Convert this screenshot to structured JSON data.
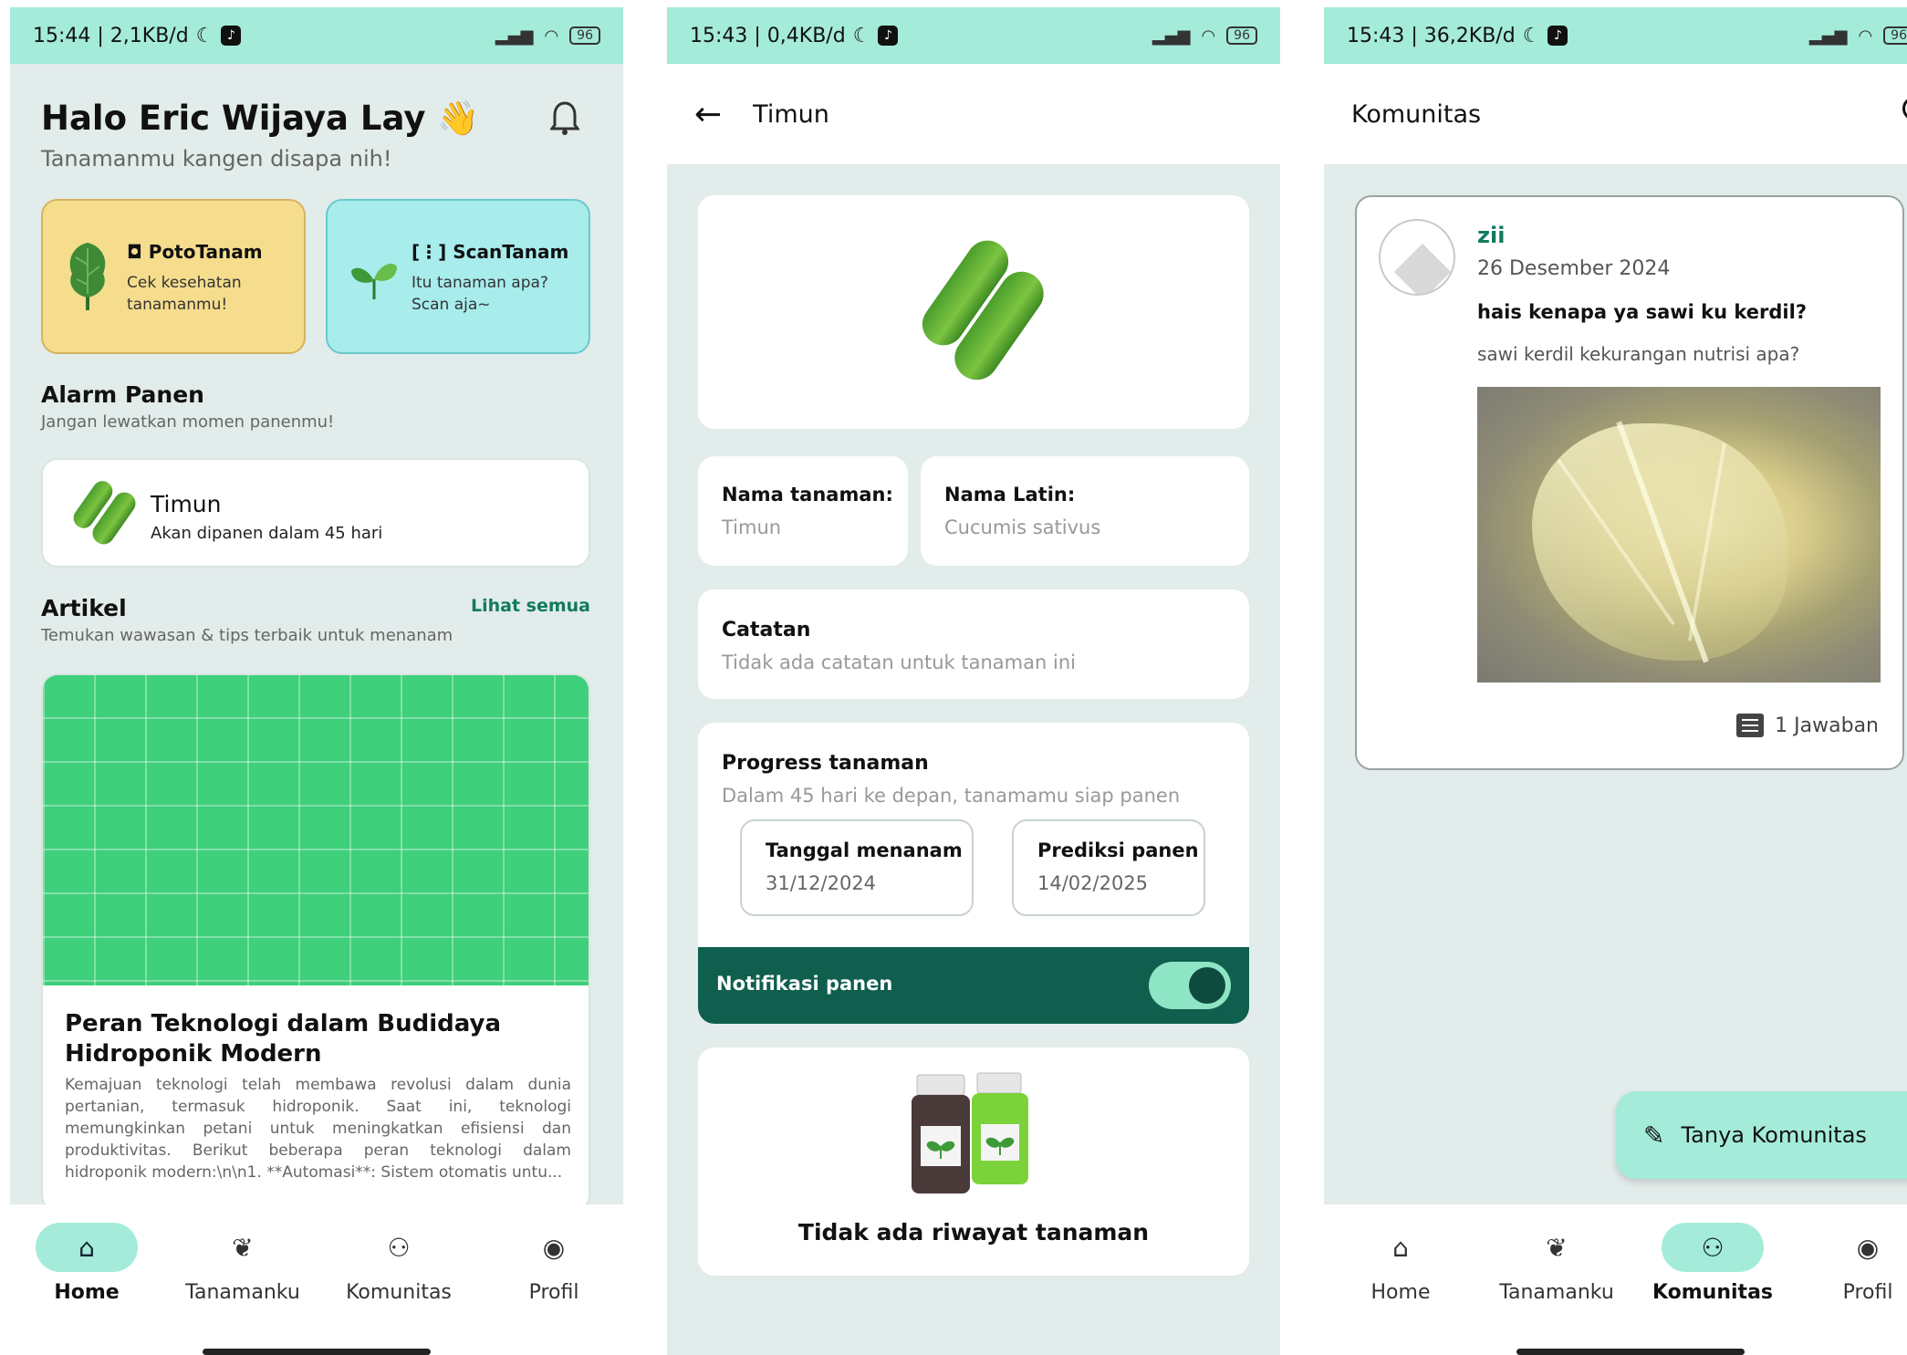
{
  "screens": {
    "home": {
      "status_time": "15:44 | 2,1KB/d",
      "battery": "96",
      "greeting": "Halo Eric Wijaya Lay",
      "wave": "👋",
      "greeting_sub": "Tanamanmu kangen disapa nih!",
      "poto": {
        "title": "PotoTanam",
        "desc": "Cek kesehatan tanamanmu!"
      },
      "scan": {
        "title": "ScanTanam",
        "desc": "Itu tanaman apa? Scan aja~"
      },
      "alarm_title": "Alarm Panen",
      "alarm_sub": "Jangan lewatkan momen panenmu!",
      "alarm_item": {
        "name": "Timun",
        "desc": "Akan dipanen dalam 45 hari"
      },
      "artikel_title": "Artikel",
      "artikel_sub": "Temukan wawasan & tips terbaik untuk menanam",
      "lihat_semua": "Lihat semua",
      "article": {
        "title": "Peran Teknologi dalam Budidaya Hidroponik Modern",
        "body": "Kemajuan teknologi telah membawa revolusi dalam dunia pertanian, termasuk hidroponik. Saat ini, teknologi memungkinkan petani untuk meningkatkan efisiensi dan produktivitas. Berikut beberapa peran teknologi dalam hidroponik modern:\\n\\n1. **Automasi**: Sistem otomatis untu..."
      }
    },
    "detail": {
      "status_time": "15:43 | 0,4KB/d",
      "battery": "96",
      "title": "Timun",
      "nama_label": "Nama tanaman:",
      "nama_value": "Timun",
      "latin_label": "Nama Latin:",
      "latin_value": "Cucumis sativus",
      "catatan_label": "Catatan",
      "catatan_value": "Tidak ada catatan untuk tanaman ini",
      "progress_label": "Progress tanaman",
      "progress_value": "Dalam 45 hari ke depan, tanamamu siap panen",
      "tanggal_label": "Tanggal menanam",
      "tanggal_value": "31/12/2024",
      "prediksi_label": "Prediksi panen",
      "prediksi_value": "14/02/2025",
      "notif_label": "Notifikasi panen",
      "riwayat_text": "Tidak ada riwayat tanaman"
    },
    "komunitas": {
      "status_time": "15:43 | 36,2KB/d",
      "battery": "96",
      "title": "Komunitas",
      "post": {
        "user": "zii",
        "date": "26 Desember 2024",
        "title": "hais kenapa ya sawi ku kerdil?",
        "body": "sawi kerdil kekurangan nutrisi apa?",
        "replies": "1 Jawaban"
      },
      "fab_label": "Tanya Komunitas"
    }
  },
  "nav": [
    "Home",
    "Tanamanku",
    "Komunitas",
    "Profil"
  ],
  "colors": {
    "mint": "#a4ebd9",
    "dark_green": "#0f5e4e",
    "accent_text": "#127a5f",
    "bg": "#e2ecea"
  }
}
